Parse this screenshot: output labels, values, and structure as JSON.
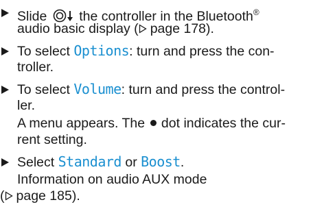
{
  "steps": [
    {
      "line1_pre": "Slide ",
      "line1_post": " the controller in the Bluetooth",
      "line1_sup": "®",
      "line2_pre": "audio basic display (",
      "line2_ref": "page 178",
      "line2_post": ")."
    },
    {
      "line1_pre": "To select ",
      "line1_hl": "Options",
      "line1_post": ": turn and press the con-",
      "line2": "troller."
    },
    {
      "line1_pre": "To select ",
      "line1_hl": "Volume",
      "line1_post": ": turn and press the control-",
      "line2": "ler.",
      "line3": "A menu appears. The ",
      "line3_post": " dot indicates the cur-",
      "line4": "rent setting."
    },
    {
      "line1_pre": "Select ",
      "line1_hl1": "Standard",
      "line1_mid": " or ",
      "line1_hl2": "Boost",
      "line1_post": ".",
      "line2": "Information on audio AUX mode",
      "line3_pre": "(",
      "line3_ref": "page 185",
      "line3_post": ")."
    }
  ]
}
